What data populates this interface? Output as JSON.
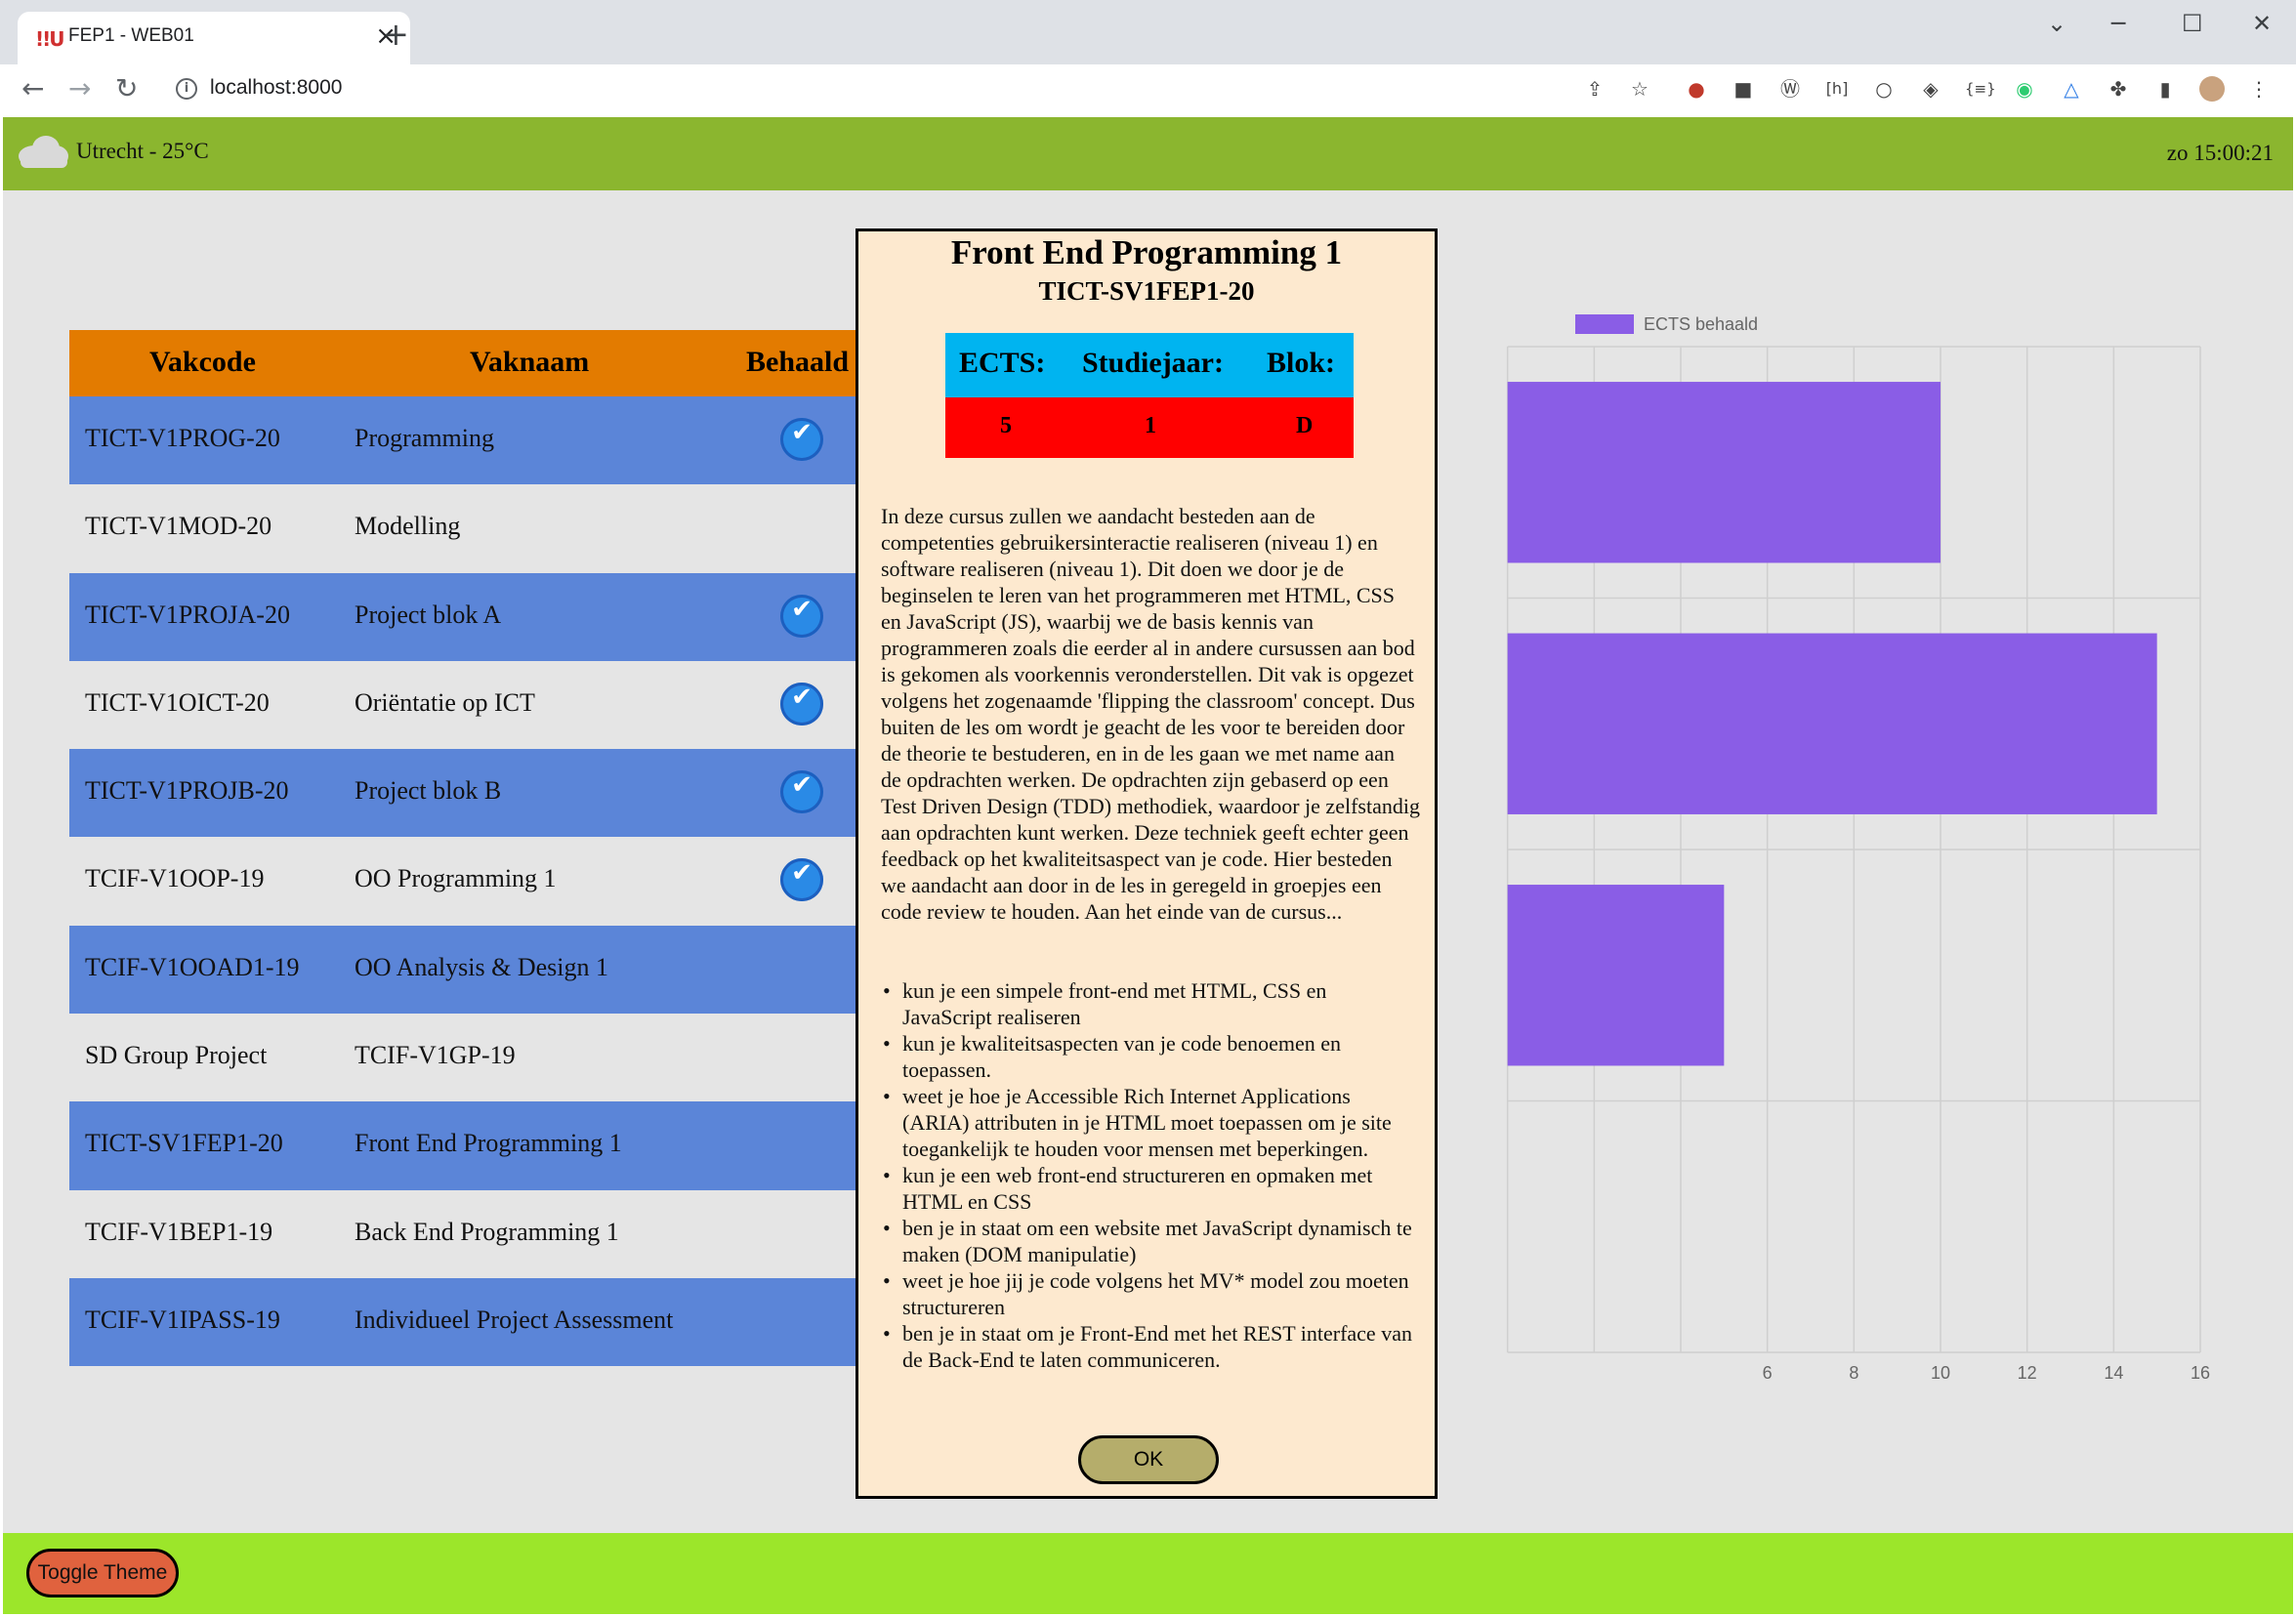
{
  "browser": {
    "tab_title": "FEP1 - WEB01",
    "url": "localhost:8000",
    "new_tab": "+",
    "close_tab": "×"
  },
  "header": {
    "weather": "Utrecht - 25°C",
    "clock": "zo 15:00:21"
  },
  "table": {
    "headers": [
      "Vakcode",
      "Vaknaam",
      "Behaald"
    ],
    "rows": [
      {
        "code": "TICT-V1PROG-20",
        "name": "Programming",
        "passed": true
      },
      {
        "code": "TICT-V1MOD-20",
        "name": "Modelling",
        "passed": false
      },
      {
        "code": "TICT-V1PROJA-20",
        "name": "Project blok A",
        "passed": true
      },
      {
        "code": "TICT-V1OICT-20",
        "name": "Oriëntatie op ICT",
        "passed": true
      },
      {
        "code": "TICT-V1PROJB-20",
        "name": "Project blok B",
        "passed": true
      },
      {
        "code": "TCIF-V1OOP-19",
        "name": "OO Programming 1",
        "passed": true
      },
      {
        "code": "TCIF-V1OOAD1-19",
        "name": "OO Analysis & Design 1",
        "passed": false
      },
      {
        "code": "SD Group Project",
        "name": "TCIF-V1GP-19",
        "passed": false
      },
      {
        "code": "TICT-SV1FEP1-20",
        "name": "Front End Programming 1",
        "passed": false
      },
      {
        "code": "TCIF-V1BEP1-19",
        "name": "Back End Programming 1",
        "passed": false
      },
      {
        "code": "TCIF-V1IPASS-19",
        "name": "Individueel Project Assessment",
        "passed": false
      }
    ]
  },
  "chart_data": {
    "type": "bar",
    "orientation": "horizontal",
    "series": [
      {
        "name": "ECTS behaald",
        "values": [
          10,
          15,
          5,
          0
        ],
        "color": "#8a5de6"
      }
    ],
    "xlim": [
      0,
      16
    ],
    "x_ticks_visible": [
      "6",
      "8",
      "10",
      "12",
      "14",
      "16"
    ],
    "grid": true,
    "legend": "top"
  },
  "modal": {
    "title": "Front End Programming 1",
    "subtitle": "TICT-SV1FEP1-20",
    "info_headers": [
      "ECTS:",
      "Studiejaar:",
      "Blok:"
    ],
    "info_values": [
      "5",
      "1",
      "D"
    ],
    "description": "In deze cursus zullen we aandacht besteden aan de competenties gebruikersinteractie realiseren (niveau 1) en software realiseren (niveau 1). Dit doen we door je de beginselen te leren van het programmeren met HTML, CSS en JavaScript (JS), waarbij we de basis kennis van programmeren zoals die eerder al in andere cursussen aan bod is gekomen als voorkennis veronderstellen. Dit vak is opgezet volgens het zogenaamde 'flipping the classroom' concept. Dus buiten de les om wordt je geacht de les voor te bereiden door de theorie te bestuderen, en in de les gaan we met name aan de opdrachten werken. De opdrachten zijn gebaserd op een Test Driven Design (TDD) methodiek, waardoor je zelfstandig aan opdrachten kunt werken. Deze techniek geeft echter geen feedback op het kwaliteitsaspect van je code. Hier besteden we aandacht aan door in de les in geregeld in groepjes een code review te houden. Aan het einde van de cursus...",
    "goals": [
      "kun je een simpele front-end met HTML, CSS en JavaScript realiseren",
      "kun je kwaliteitsaspecten van je code benoemen en toepassen.",
      "weet je hoe je Accessible Rich Internet Applications (ARIA) attributen in je HTML moet toepassen om je site toegankelijk te houden voor mensen met beperkingen.",
      "kun je een web front-end structureren en opmaken met HTML en CSS",
      "ben je in staat om een website met JavaScript dynamisch te maken (DOM manipulatie)",
      "weet je hoe jij je code volgens het MV* model zou moeten structureren",
      "ben je in staat om je Front-End met het REST interface van de Back-End te laten communiceren."
    ],
    "ok_label": "OK"
  },
  "footer": {
    "toggle_label": "Toggle Theme"
  },
  "icons": {
    "check": "✔",
    "back": "←",
    "forward": "→",
    "reload": "↻"
  }
}
